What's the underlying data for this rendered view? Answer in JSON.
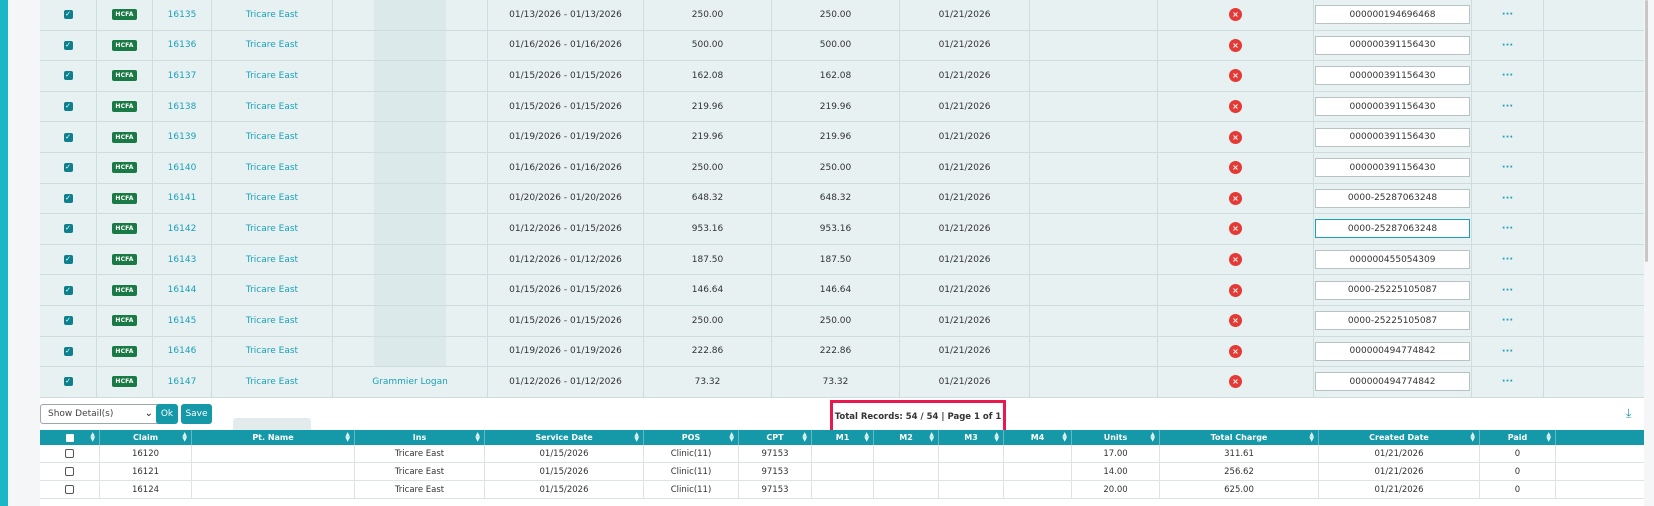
{
  "top_rows": [
    {
      "claim": "16135",
      "ins": "Tricare East",
      "patient": "",
      "service": "01/13/2026 - 01/13/2026",
      "charge": "250.00",
      "balance": "250.00",
      "date": "01/21/2026",
      "ref": "000000194696468",
      "active": false
    },
    {
      "claim": "16136",
      "ins": "Tricare East",
      "patient": "",
      "service": "01/16/2026 - 01/16/2026",
      "charge": "500.00",
      "balance": "500.00",
      "date": "01/21/2026",
      "ref": "000000391156430",
      "active": false
    },
    {
      "claim": "16137",
      "ins": "Tricare East",
      "patient": "",
      "service": "01/15/2026 - 01/15/2026",
      "charge": "162.08",
      "balance": "162.08",
      "date": "01/21/2026",
      "ref": "000000391156430",
      "active": false
    },
    {
      "claim": "16138",
      "ins": "Tricare East",
      "patient": "",
      "service": "01/15/2026 - 01/15/2026",
      "charge": "219.96",
      "balance": "219.96",
      "date": "01/21/2026",
      "ref": "000000391156430",
      "active": false
    },
    {
      "claim": "16139",
      "ins": "Tricare East",
      "patient": "",
      "service": "01/19/2026 - 01/19/2026",
      "charge": "219.96",
      "balance": "219.96",
      "date": "01/21/2026",
      "ref": "000000391156430",
      "active": false
    },
    {
      "claim": "16140",
      "ins": "Tricare East",
      "patient": "",
      "service": "01/16/2026 - 01/16/2026",
      "charge": "250.00",
      "balance": "250.00",
      "date": "01/21/2026",
      "ref": "000000391156430",
      "active": false
    },
    {
      "claim": "16141",
      "ins": "Tricare East",
      "patient": "",
      "service": "01/20/2026 - 01/20/2026",
      "charge": "648.32",
      "balance": "648.32",
      "date": "01/21/2026",
      "ref": "0000-25287063248",
      "active": false
    },
    {
      "claim": "16142",
      "ins": "Tricare East",
      "patient": "",
      "service": "01/12/2026 - 01/15/2026",
      "charge": "953.16",
      "balance": "953.16",
      "date": "01/21/2026",
      "ref": "0000-25287063248",
      "active": true
    },
    {
      "claim": "16143",
      "ins": "Tricare East",
      "patient": "",
      "service": "01/12/2026 - 01/12/2026",
      "charge": "187.50",
      "balance": "187.50",
      "date": "01/21/2026",
      "ref": "000000455054309",
      "active": false
    },
    {
      "claim": "16144",
      "ins": "Tricare East",
      "patient": "",
      "service": "01/15/2026 - 01/15/2026",
      "charge": "146.64",
      "balance": "146.64",
      "date": "01/21/2026",
      "ref": "0000-25225105087",
      "active": false
    },
    {
      "claim": "16145",
      "ins": "Tricare East",
      "patient": "",
      "service": "01/15/2026 - 01/15/2026",
      "charge": "250.00",
      "balance": "250.00",
      "date": "01/21/2026",
      "ref": "0000-25225105087",
      "active": false
    },
    {
      "claim": "16146",
      "ins": "Tricare East",
      "patient": "",
      "service": "01/19/2026 - 01/19/2026",
      "charge": "222.86",
      "balance": "222.86",
      "date": "01/21/2026",
      "ref": "000000494774842",
      "active": false
    },
    {
      "claim": "16147",
      "ins": "Tricare East",
      "patient": "Grammier Logan",
      "service": "01/12/2026 - 01/12/2026",
      "charge": "73.32",
      "balance": "73.32",
      "date": "01/21/2026",
      "ref": "000000494774842",
      "active": false
    }
  ],
  "badge": "HCFA",
  "toolbar": {
    "select_value": "Show Detail(s)",
    "ok_label": "Ok",
    "save_label": "Save",
    "records_text": "Total Records: 54 / 54 | Page 1 of 1"
  },
  "bottom_headers": [
    "Claim",
    "Pt. Name",
    "Ins",
    "Service Date",
    "POS",
    "CPT",
    "M1",
    "M2",
    "M3",
    "M4",
    "Units",
    "Total Charge",
    "Created Date",
    "Paid"
  ],
  "bottom_rows": [
    {
      "claim": "16120",
      "pt": "",
      "ins": "Tricare East",
      "service": "01/15/2026",
      "pos": "Clinic(11)",
      "cpt": "97153",
      "m1": "",
      "m2": "",
      "m3": "",
      "m4": "",
      "units": "17.00",
      "total": "311.61",
      "created": "01/21/2026",
      "paid": "0"
    },
    {
      "claim": "16121",
      "pt": "",
      "ins": "Tricare East",
      "service": "01/15/2026",
      "pos": "Clinic(11)",
      "cpt": "97153",
      "m1": "",
      "m2": "",
      "m3": "",
      "m4": "",
      "units": "14.00",
      "total": "256.62",
      "created": "01/21/2026",
      "paid": "0"
    },
    {
      "claim": "16124",
      "pt": "",
      "ins": "Tricare East",
      "service": "01/15/2026",
      "pos": "Clinic(11)",
      "cpt": "97153",
      "m1": "",
      "m2": "",
      "m3": "",
      "m4": "",
      "units": "20.00",
      "total": "625.00",
      "created": "01/21/2026",
      "paid": "0"
    }
  ],
  "colors": {
    "accent": "#1598a8",
    "link": "#1ba0b8",
    "highlight": "#e8194f",
    "error": "#e53935",
    "badge": "#1a7a45"
  },
  "icons": {
    "checkbox": "checked-checkbox-icon",
    "error": "x-circle-icon",
    "more": "ellipsis-icon",
    "download": "download-icon",
    "dropdown": "chevron-down-icon",
    "sort": "sort-icon"
  }
}
